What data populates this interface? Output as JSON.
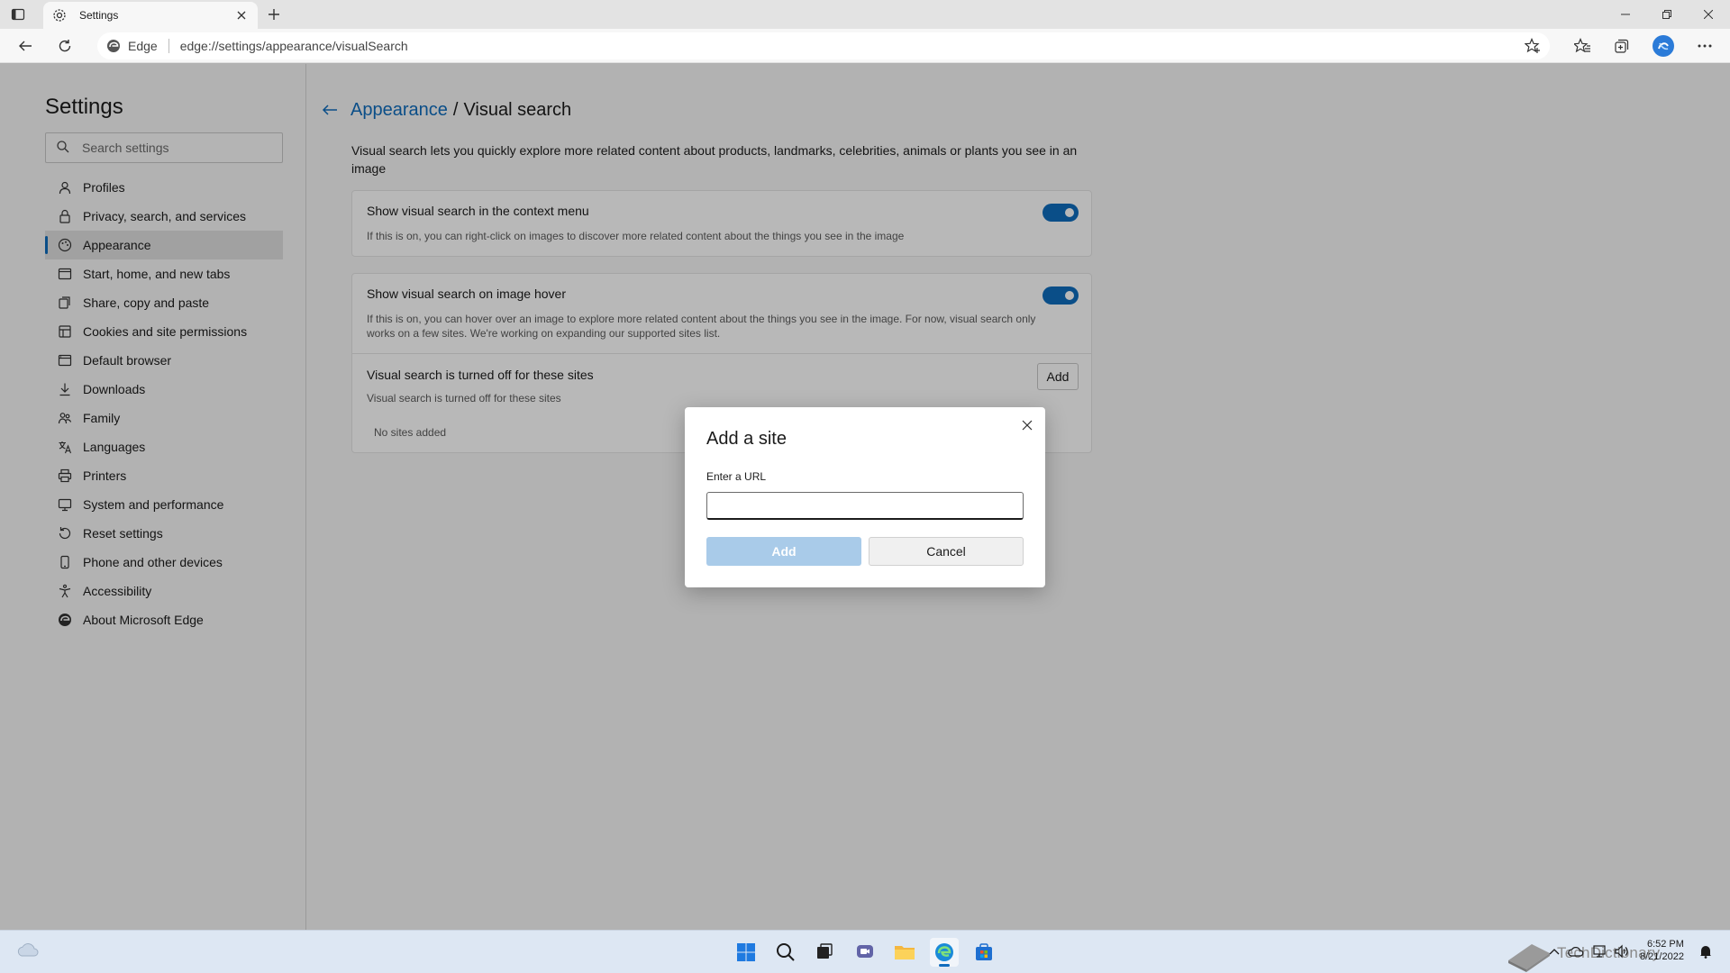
{
  "browser": {
    "tab_title": "Settings",
    "site_chip": "Edge",
    "url": "edge://settings/appearance/visualSearch"
  },
  "sidebar": {
    "title": "Settings",
    "search_placeholder": "Search settings",
    "items": [
      {
        "label": "Profiles",
        "icon": "profile-icon"
      },
      {
        "label": "Privacy, search, and services",
        "icon": "lock-icon"
      },
      {
        "label": "Appearance",
        "icon": "appearance-icon",
        "active": true
      },
      {
        "label": "Start, home, and new tabs",
        "icon": "start-icon"
      },
      {
        "label": "Share, copy and paste",
        "icon": "share-icon"
      },
      {
        "label": "Cookies and site permissions",
        "icon": "cookies-icon"
      },
      {
        "label": "Default browser",
        "icon": "browser-icon"
      },
      {
        "label": "Downloads",
        "icon": "download-icon"
      },
      {
        "label": "Family",
        "icon": "family-icon"
      },
      {
        "label": "Languages",
        "icon": "language-icon"
      },
      {
        "label": "Printers",
        "icon": "printer-icon"
      },
      {
        "label": "System and performance",
        "icon": "system-icon"
      },
      {
        "label": "Reset settings",
        "icon": "reset-icon"
      },
      {
        "label": "Phone and other devices",
        "icon": "phone-icon"
      },
      {
        "label": "Accessibility",
        "icon": "accessibility-icon"
      },
      {
        "label": "About Microsoft Edge",
        "icon": "edge-icon"
      }
    ]
  },
  "main": {
    "breadcrumb_parent": "Appearance",
    "breadcrumb_separator": "/",
    "breadcrumb_current": "Visual search",
    "description": "Visual search lets you quickly explore more related content about products, landmarks, celebrities, animals or plants you see in an image",
    "context_menu": {
      "title": "Show visual search in the context menu",
      "subtitle": "If this is on, you can right-click on images to discover more related content about the things you see in the image",
      "enabled": true
    },
    "image_hover": {
      "title": "Show visual search on image hover",
      "subtitle": "If this is on, you can hover over an image to explore more related content about the things you see in the image. For now, visual search only works on a few sites. We're working on expanding our supported sites list.",
      "enabled": true
    },
    "blocked_sites": {
      "title": "Visual search is turned off for these sites",
      "subtitle": "Visual search is turned off for these sites",
      "add_label": "Add",
      "empty_text": "No sites added"
    }
  },
  "dialog": {
    "title": "Add a site",
    "field_label": "Enter a URL",
    "field_value": "",
    "add_label": "Add",
    "cancel_label": "Cancel"
  },
  "taskbar": {
    "time": "6:52 PM",
    "date": "8/21/2022",
    "watermark": "TechDictionary"
  },
  "colors": {
    "accent": "#0f6cbd",
    "disabled_button": "#a9cbe9"
  }
}
